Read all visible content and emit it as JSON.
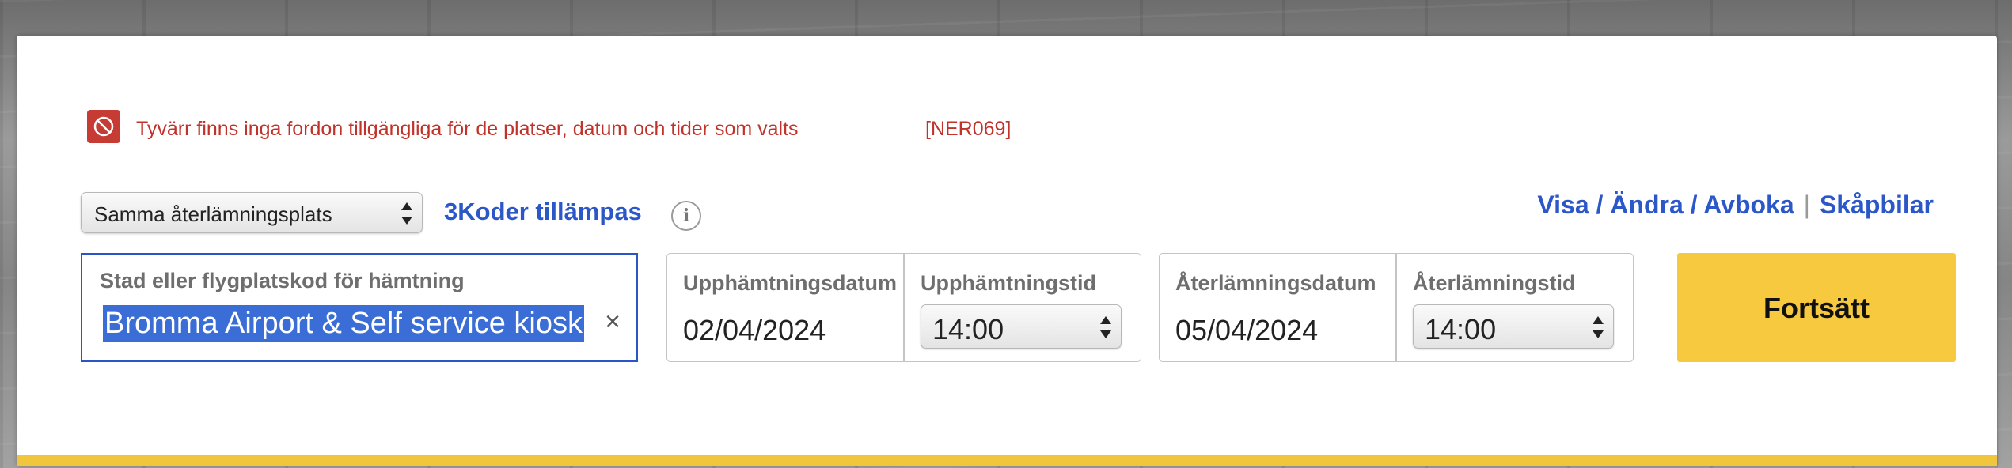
{
  "error": {
    "message": "Tyvärr finns inga fordon tillgängliga för de platser, datum och tider som valts",
    "code": "[NER069]",
    "icon": "no-entry-icon"
  },
  "return_option": {
    "selected": "Samma återlämningsplats"
  },
  "promo": {
    "label": "3Koder tillämpas",
    "info_icon": "i"
  },
  "top_links": {
    "manage": "Visa / Ändra / Avboka",
    "separator": "|",
    "vans": "Skåpbilar"
  },
  "pickup_location": {
    "label": "Stad eller flygplatskod för hämtning",
    "value": "Bromma Airport & Self service kiosk",
    "clear": "×"
  },
  "pickup": {
    "date_label": "Upphämtningsdatum",
    "date_value": "02/04/2024",
    "time_label": "Upphämtningstid",
    "time_value": "14:00"
  },
  "dropoff": {
    "date_label": "Återlämningsdatum",
    "date_value": "05/04/2024",
    "time_label": "Återlämningstid",
    "time_value": "14:00"
  },
  "continue_button": {
    "label": "Fortsätt"
  },
  "colors": {
    "accent_blue": "#2b57c9",
    "error_red": "#c0322a",
    "button_yellow": "#f6c93f"
  }
}
